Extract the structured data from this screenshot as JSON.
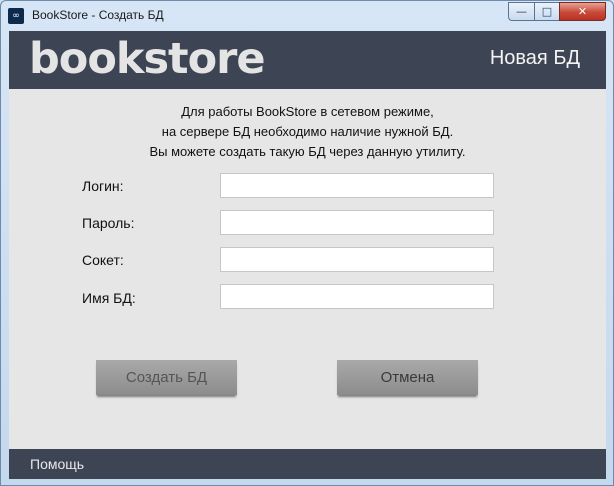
{
  "window": {
    "title": "BookStore - Создать БД",
    "controls": {
      "minimize": "—",
      "maximize": "□",
      "close": "✕"
    }
  },
  "header": {
    "logo": "bookstore",
    "title": "Новая БД"
  },
  "intro": {
    "lines": [
      "Для работы BookStore в сетевом режиме,",
      "на сервере БД необходимо наличие нужной БД.",
      "Вы можете создать такую БД через данную утилиту."
    ]
  },
  "form": {
    "login_label": "Логин:",
    "login_value": "",
    "password_label": "Пароль:",
    "password_value": "",
    "socket_label": "Сокет:",
    "socket_value": "",
    "dbname_label": "Имя БД:",
    "dbname_value": ""
  },
  "buttons": {
    "create": "Создать БД",
    "cancel": "Отмена"
  },
  "footer": {
    "help": "Помощь"
  },
  "colors": {
    "header_bg": "#3d4554",
    "body_bg": "#e6e6e6",
    "button_bg": "#999999"
  }
}
